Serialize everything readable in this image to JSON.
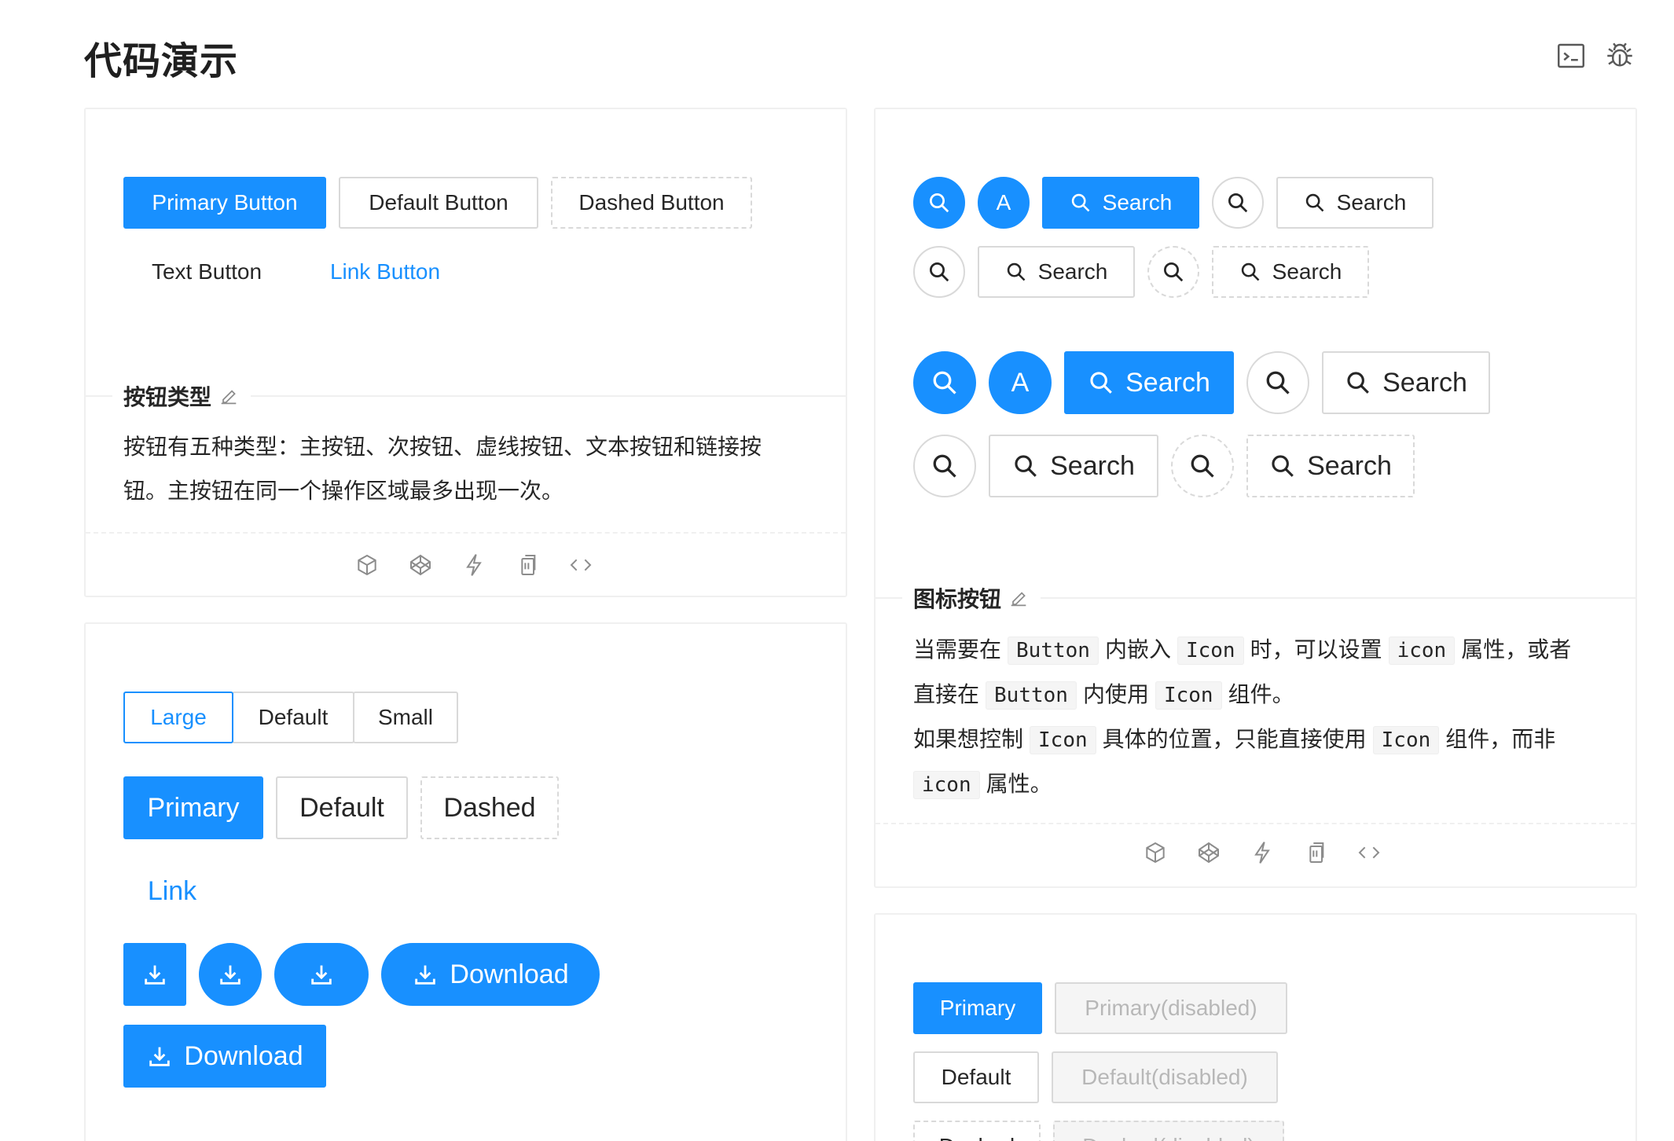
{
  "page": {
    "title": "代码演示"
  },
  "colors": {
    "primary": "#1890ff",
    "border": "#d9d9d9",
    "disabled_bg": "#f5f5f5",
    "text": "#262626"
  },
  "toolbar_icons": [
    "terminal-icon",
    "bug-icon"
  ],
  "button_types": {
    "buttons": {
      "primary": "Primary Button",
      "default": "Default Button",
      "dashed": "Dashed Button",
      "text": "Text Button",
      "link": "Link Button"
    },
    "meta": {
      "title": "按钮类型",
      "description": "按钮有五种类型：主按钮、次按钮、虚线按钮、文本按钮和链接按钮。主按钮在同一个操作区域最多出现一次。"
    }
  },
  "icon_buttons": {
    "circle_letter": "A",
    "search_label": "Search",
    "meta": {
      "title": "图标按钮",
      "line1": {
        "a": "当需要在",
        "code1": "Button",
        "b": "内嵌入",
        "code2": "Icon",
        "c": "时，可以设置",
        "code3": "icon",
        "d": "属性，或者"
      },
      "line2": {
        "a": "直接在",
        "code1": "Button",
        "b": "内使用",
        "code2": "Icon",
        "c": "组件。"
      },
      "line3": {
        "a": "如果想控制",
        "code1": "Icon",
        "b": "具体的位置，只能直接使用",
        "code2": "Icon",
        "c": "组件，而非"
      },
      "line4": {
        "code1": "icon",
        "a": "属性。"
      }
    }
  },
  "button_size": {
    "radio": [
      "Large",
      "Default",
      "Small"
    ],
    "selected_size": "Large",
    "buttons": {
      "primary": "Primary",
      "default": "Default",
      "dashed": "Dashed",
      "link": "Link",
      "download": "Download"
    }
  },
  "disabled_demo": {
    "primary": "Primary",
    "primary_disabled": "Primary(disabled)",
    "default": "Default",
    "default_disabled": "Default(disabled)",
    "dashed": "Dashed",
    "dashed_disabled": "Dashed(disabled)"
  },
  "action_icons": [
    "codesandbox-icon",
    "codepen-icon",
    "thunderbolt-icon",
    "copy-icon",
    "code-icon"
  ]
}
